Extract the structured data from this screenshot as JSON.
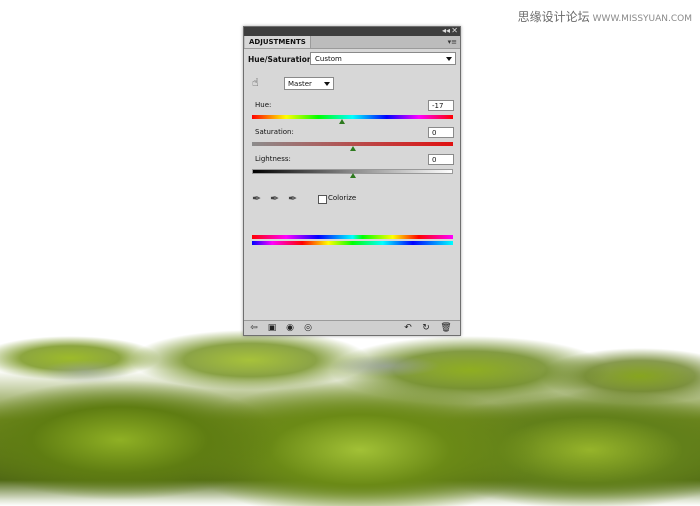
{
  "watermark": {
    "text": "思缘设计论坛",
    "url": "WWW.MISSYUAN.COM"
  },
  "panel": {
    "tab_label": "ADJUSTMENTS",
    "preset_label": "Hue/Saturation",
    "preset_value": "Custom",
    "channel": "Master",
    "hue": {
      "label": "Hue:",
      "value": "-17",
      "level": 0.45
    },
    "saturation": {
      "label": "Saturation:",
      "value": "0",
      "level": 0.5
    },
    "lightness": {
      "label": "Lightness:",
      "value": "0",
      "level": 0.5
    },
    "colorize_label": "Colorize",
    "colorize_checked": false
  },
  "icons": {
    "collapse": "double-chevron-left-icon",
    "close": "close-icon",
    "menu": "panel-menu-icon",
    "hand": "target-adjust-hand-icon",
    "eyedroppers": [
      "eyedropper-icon",
      "eyedropper-plus-icon",
      "eyedropper-minus-icon"
    ],
    "bottom_left": [
      "return-icon",
      "clip-layer-icon",
      "layer-visibility-icon",
      "eye-icon"
    ],
    "bottom_right": [
      "previous-state-icon",
      "reset-icon",
      "trash-icon"
    ]
  },
  "colors": {
    "panel_bg": "#d7d7d7",
    "thumb": "#2d7a1e",
    "title_bar": "#3e3e3e"
  }
}
